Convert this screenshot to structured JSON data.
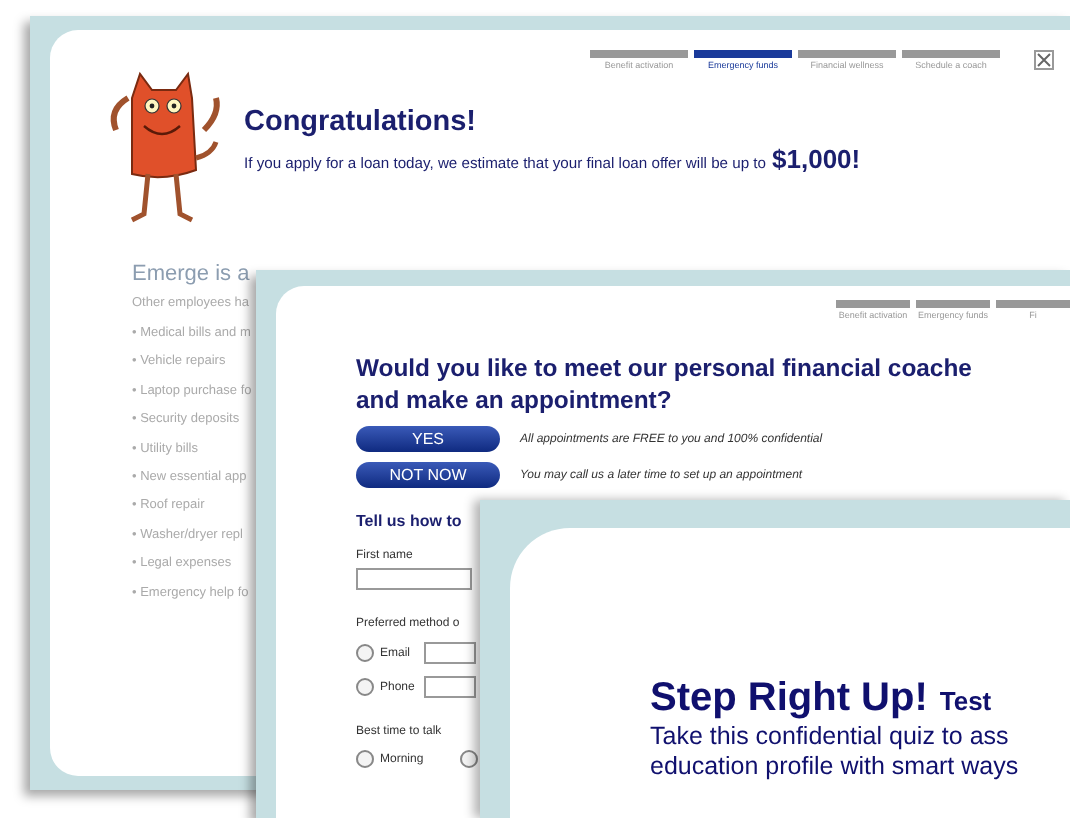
{
  "loan_window": {
    "steps": [
      {
        "label": "Benefit activation",
        "selected": false
      },
      {
        "label": "Emergency funds",
        "selected": true
      },
      {
        "label": "Financial wellness",
        "selected": false
      },
      {
        "label": "Schedule a coach",
        "selected": false
      }
    ],
    "title": "Congratulations!",
    "message": "If you apply for a loan today, we estimate that your final loan offer will be up to",
    "amount": "$1,000!",
    "section_title": "Emerge is a",
    "section_intro": "Other employees ha",
    "uses": [
      "• Medical bills and m",
      "• Vehicle repairs",
      "• Laptop purchase fo",
      "• Security deposits",
      "• Utility bills",
      "• New essential app",
      "• Roof repair",
      "• Washer/dryer repl",
      "• Legal expenses",
      "• Emergency help fo"
    ]
  },
  "coach_window": {
    "steps": [
      {
        "label": "Benefit activation",
        "selected": false
      },
      {
        "label": "Emergency funds",
        "selected": false
      },
      {
        "label": "Fi",
        "selected": false
      }
    ],
    "heading_lines": [
      "Would you like to meet our personal financial coache",
      "and make an appointment?"
    ],
    "choices": [
      {
        "label": "YES",
        "note": "All appointments are FREE to you and 100% confidential"
      },
      {
        "label": "NOT NOW",
        "note": "You may call us a later time to set up an appointment"
      }
    ],
    "form_title": "Tell us how to",
    "first_name_label": "First name",
    "method_label": "Preferred method o",
    "methods": [
      {
        "label": "Email",
        "checked": false
      },
      {
        "label": "Phone",
        "checked": false
      }
    ],
    "time_label": "Best time to talk",
    "times": [
      {
        "label": "Morning",
        "checked": false
      },
      {
        "checked": false
      }
    ]
  },
  "quiz_window": {
    "title": "Step Right Up!",
    "subtitle": "Test",
    "lines": [
      "Take this confidential quiz to ass",
      "education profile with smart ways"
    ]
  }
}
